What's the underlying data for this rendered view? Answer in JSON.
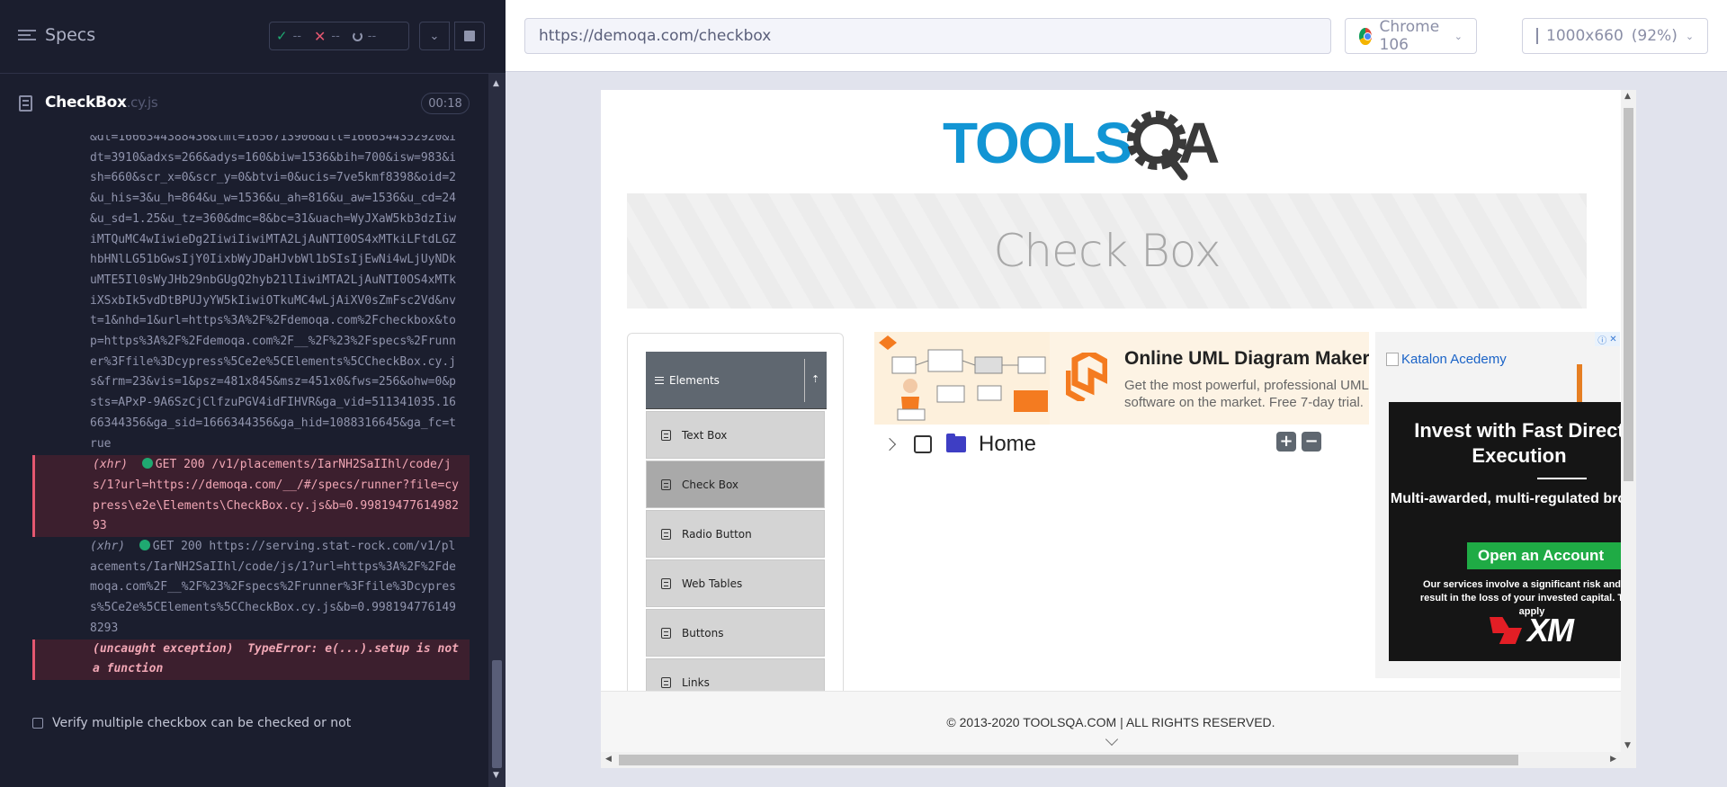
{
  "reporter": {
    "specs_label": "Specs",
    "stats": {
      "passed": "--",
      "failed": "--",
      "pending": "--"
    },
    "spec": {
      "name": "CheckBox",
      "ext": ".cy.js",
      "duration": "00:18"
    },
    "log_text": "&dt=1666344388436&lmt=1656713906&dlt=1666344352920&idt=3910&adxs=266&adys=160&biw=1536&bih=700&isw=983&ish=660&scr_x=0&scr_y=0&btvi=0&ucis=7ve5kmf8398&oid=2&u_his=3&u_h=864&u_w=1536&u_ah=816&u_aw=1536&u_cd=24&u_sd=1.25&u_tz=360&dmc=8&bc=31&uach=WyJXaW5kb3dzIiwiMTQuMC4wIiwieDg2IiwiIiwiMTA2LjAuNTI0OS4xMTkiLFtdLGZhbHNlLG51bGwsIjY0IixbWyJDaHJvbWl1bSIsIjEwNi4wLjUyNDkuMTE5Il0sWyJHb29nbGUgQ2hyb21lIiwiMTA2LjAuNTI0OS4xMTkiXSxbIk5vdDtBPUJyYW5kIiwiOTkuMC4wLjAiXV0sZmFsc2Vd&nvt=1&nhd=1&url=https%3A%2F%2Fdemoqa.com%2Fcheckbox&top=https%3A%2F%2Fdemoqa.com%2F__%2F%23%2Fspecs%2Frunner%3Ffile%3Dcypress%5Ce2e%5CElements%5CCheckBox.cy.js&frm=23&vis=1&psz=481x845&msz=451x0&fws=256&ohw=0&psts=APxP-9A6SzCjClfzuPGV4idFIHVR&ga_vid=511341035.1666344356&ga_sid=1666344356&ga_hid=1088316645&ga_fc=true",
    "cmd1": {
      "tag": "(xhr)",
      "status": "GET 200",
      "text": "/v1/placements/IarNH2SaIIhl/code/js/1?url=https://demoqa.com/__/#/specs/runner?file=cypress\\e2e\\Elements\\CheckBox.cy.js&b=0.9981947761498293"
    },
    "cmd2": {
      "tag": "(xhr)",
      "status": "GET 200",
      "text": "https://serving.stat-rock.com/v1/placements/IarNH2SaIIhl/code/js/1?url=https%3A%2F%2Fdemoqa.com%2F__%2F%23%2Fspecs%2Frunner%3Ffile%3Dcypress%5Ce2e%5CElements%5CCheckBox.cy.js&b=0.9981947761498293"
    },
    "cmd3": {
      "tag": "(uncaught exception)",
      "text": "TypeError: e(...).setup is not a function"
    },
    "test_title": "Verify multiple checkbox can be checked or not"
  },
  "aut": {
    "url": "https://demoqa.com/checkbox",
    "browser": "Chrome 106",
    "viewport": "1000x660",
    "zoom": "(92%)"
  },
  "page": {
    "banner_title": "Check Box",
    "group": "Elements",
    "menu": [
      "Text Box",
      "Check Box",
      "Radio Button",
      "Web Tables",
      "Buttons",
      "Links"
    ],
    "active_menu_index": 1,
    "tree_root": "Home",
    "footer": "© 2013-2020 TOOLSQA.COM | ALL RIGHTS RESERVED."
  },
  "ads": {
    "uml_title": "Online UML Diagram Maker",
    "uml_desc": "Get the most powerful, professional UML software on the market. Free 7-day trial.",
    "katalon_alt": "Katalon Acedemy",
    "xm_headline": "Invest with Fast Direct Execution",
    "xm_sub": "Multi-awarded, multi-regulated broker",
    "xm_button": "Open an Account",
    "xm_small": "Our services involve a significant risk and can result in the loss of your invested capital. T&Cs apply",
    "xm_logo": "XM"
  },
  "colors": {
    "pass": "#1fa971",
    "fail": "#e45770",
    "reporter_bg": "#1b1e2e",
    "toolsqa_blue": "#1295d4",
    "toolsqa_dark": "#3a3a3a"
  }
}
